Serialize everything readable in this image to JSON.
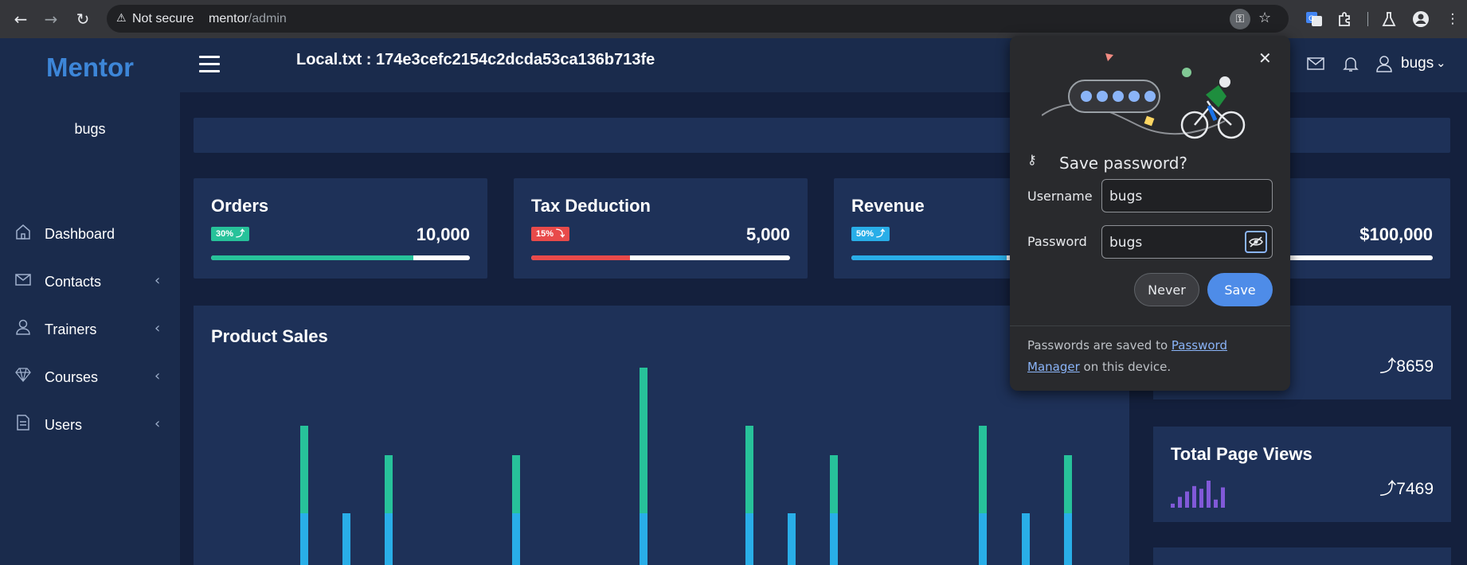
{
  "browser": {
    "security_label": "Not secure",
    "url_host": "mentor",
    "url_path": "/admin"
  },
  "sidebar": {
    "brand": "Mentor",
    "user": "bugs",
    "items": [
      {
        "label": "Dashboard",
        "icon": "home-icon"
      },
      {
        "label": "Contacts",
        "icon": "mail-icon"
      },
      {
        "label": "Trainers",
        "icon": "user-icon"
      },
      {
        "label": "Courses",
        "icon": "diamond-icon"
      },
      {
        "label": "Users",
        "icon": "document-icon"
      }
    ]
  },
  "topbar": {
    "title": "Local.txt : 174e3cefc2154c2dcda53ca136b713fe",
    "user": "bugs"
  },
  "cards": [
    {
      "title": "Orders",
      "badge": "30% ⤴",
      "value": "10,000",
      "progress": 0.78,
      "color": "#27c29a",
      "badge_color": "#27c29a"
    },
    {
      "title": "Tax Deduction",
      "badge": "15% ⤵",
      "value": "5,000",
      "progress": 0.38,
      "color": "#e84a4a",
      "badge_color": "#e84a4a"
    },
    {
      "title": "Revenue",
      "badge": "50% ⤴",
      "value": "",
      "progress": 0.6,
      "color": "#29aee8",
      "badge_color": "#29aee8"
    },
    {
      "title": "",
      "badge": "",
      "value": "$100,000",
      "progress": 0.2,
      "color": "#8159d8",
      "badge_color": "#8159d8"
    }
  ],
  "sales": {
    "title": "Product Sales"
  },
  "chart_data": {
    "type": "bar",
    "title": "Product Sales",
    "series": [
      {
        "name": "",
        "color": "#29aee8",
        "values": [
          65,
          65,
          65,
          65,
          65,
          65,
          65,
          65,
          65,
          65,
          65,
          65
        ]
      },
      {
        "name": "",
        "color": "#27c29a",
        "values": [
          110,
          0,
          73,
          73,
          183,
          110,
          0,
          73,
          110,
          0,
          73,
          0
        ]
      }
    ],
    "categories": [
      "",
      "",
      "",
      "",
      "",
      "",
      "",
      "",
      "",
      "",
      "",
      ""
    ]
  },
  "right_cards": [
    {
      "title": "",
      "value": "⤴8659"
    },
    {
      "title": "Total Page Views",
      "value": "⤴7469"
    }
  ],
  "sparkline": [
    3,
    8,
    12,
    16,
    14,
    20,
    6,
    15
  ],
  "password_popup": {
    "heading": "Save password?",
    "username_label": "Username",
    "username_value": "bugs",
    "password_label": "Password",
    "password_value": "bugs",
    "never_label": "Never",
    "save_label": "Save",
    "footer_pre": "Passwords are saved to ",
    "footer_link": "Password Manager",
    "footer_post": " on this device."
  }
}
